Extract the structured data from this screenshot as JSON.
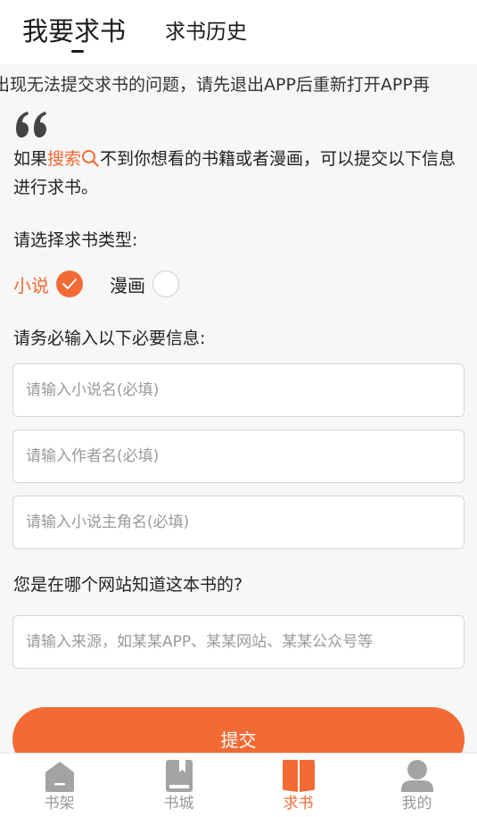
{
  "header": {
    "tab_request": "我要求书",
    "tab_history": "求书历史"
  },
  "notice": "出现无法提交求书的问题，请先退出APP后重新打开APP再",
  "intro": {
    "prefix": "如果",
    "search_link": "搜索",
    "suffix": "不到你想看的书籍或者漫画，可以提交以下信息进行求书。"
  },
  "type_section": {
    "label": "请选择求书类型:",
    "options": [
      {
        "label": "小说",
        "selected": true
      },
      {
        "label": "漫画",
        "selected": false
      }
    ]
  },
  "required_section": {
    "label": "请务必输入以下必要信息:",
    "fields": [
      {
        "placeholder": "请输入小说名(必填)",
        "value": ""
      },
      {
        "placeholder": "请输入作者名(必填)",
        "value": ""
      },
      {
        "placeholder": "请输入小说主角名(必填)",
        "value": ""
      }
    ]
  },
  "source_section": {
    "label": "您是在哪个网站知道这本书的?",
    "placeholder": "请输入来源，如某某APP、某某网站、某某公众号等",
    "value": ""
  },
  "submit_label": "提交",
  "bottom_nav": {
    "items": [
      {
        "label": "书架",
        "icon": "bookshelf-icon",
        "active": false
      },
      {
        "label": "书城",
        "icon": "book-icon",
        "active": false
      },
      {
        "label": "求书",
        "icon": "open-book-icon",
        "active": true
      },
      {
        "label": "我的",
        "icon": "user-icon",
        "active": false
      }
    ]
  },
  "colors": {
    "accent": "#f26b35",
    "inactive": "#9a9a9a",
    "background": "#f7f7f7"
  }
}
